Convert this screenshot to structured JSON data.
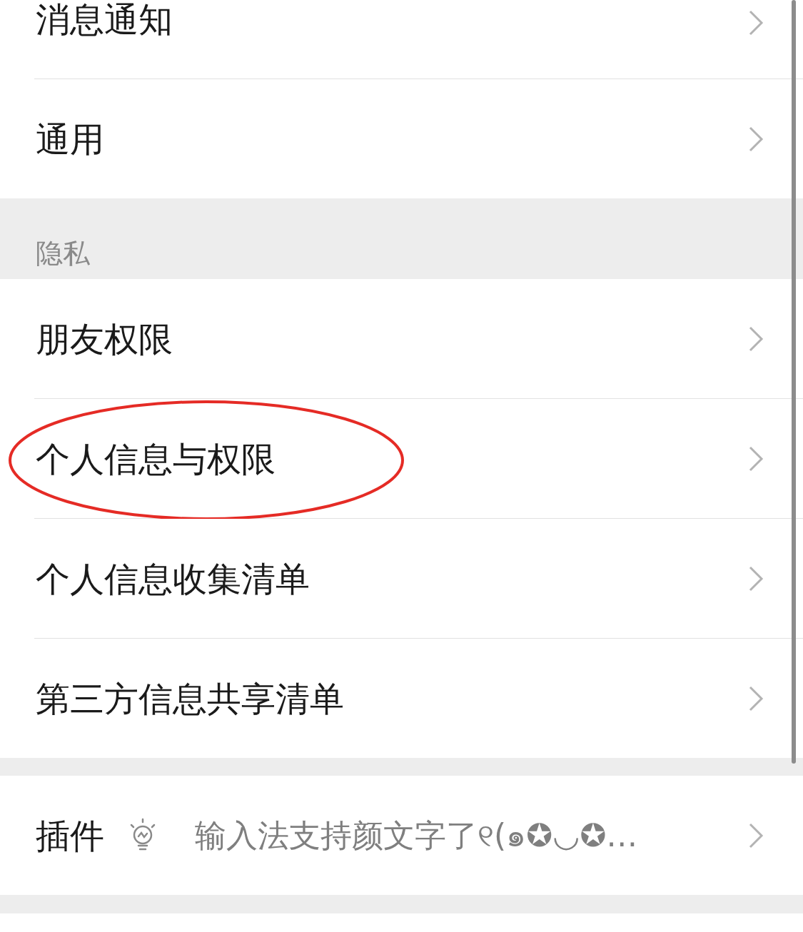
{
  "groups": [
    {
      "items": [
        {
          "label": "消息通知",
          "cut_top": true
        },
        {
          "label": "通用"
        }
      ]
    },
    {
      "header": "隐私",
      "items": [
        {
          "label": "朋友权限"
        },
        {
          "label": "个人信息与权限",
          "highlighted": true
        },
        {
          "label": "个人信息收集清单"
        },
        {
          "label": "第三方信息共享清单"
        }
      ]
    },
    {
      "items": [
        {
          "label": "插件",
          "kind": "plugin",
          "value": "输入法支持颜文字了୧(๑✪◡✪…"
        }
      ]
    }
  ]
}
